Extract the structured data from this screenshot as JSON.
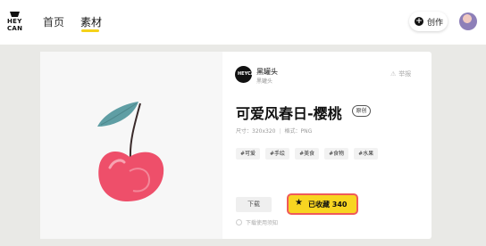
{
  "brand": {
    "line1": "HEY",
    "line2": "CAN"
  },
  "nav": {
    "home": "首页",
    "material": "素材"
  },
  "header": {
    "create_label": "创作"
  },
  "author": {
    "avatar_text": "HEYCAN",
    "name": "黑罐头",
    "subtitle": "黑罐头"
  },
  "report_label": "举报",
  "detail": {
    "title": "可爱风春日-樱桃",
    "badge": "原创",
    "size": "尺寸：320x320",
    "format": "格式：PNG",
    "tags": [
      "#可爱",
      "#手绘",
      "#美食",
      "#食物",
      "#水果"
    ]
  },
  "actions": {
    "download_label": "下载",
    "favorite_label": "已收藏 340",
    "notice": "下载使用须知"
  },
  "colors": {
    "accent_yellow": "#f8d521",
    "highlight_red": "#ef5a5a",
    "cherry_red": "#ee4f6a",
    "leaf_teal": "#5f9ea4"
  }
}
